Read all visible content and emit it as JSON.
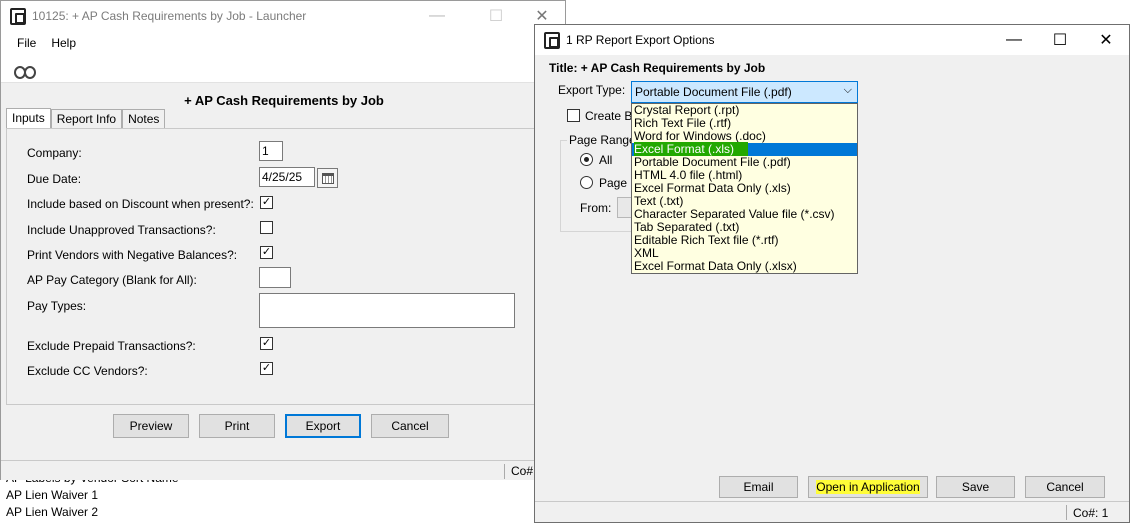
{
  "background_list": [
    "AP Labels by Vendor Sort Name",
    "AP Lien Waiver 1",
    "AP Lien Waiver 2"
  ],
  "launcher": {
    "title": "10125: + AP Cash Requirements by Job - Launcher",
    "controls": {
      "minimize": "—",
      "maximize": "☐",
      "close": "✕"
    },
    "menu": [
      "File",
      "Help"
    ],
    "report_title": "+ AP Cash Requirements by Job",
    "tabs": [
      "Inputs",
      "Report Info",
      "Notes"
    ],
    "fields": {
      "company_label": "Company:",
      "company_value": "1",
      "due_date_label": "Due Date:",
      "due_date_value": "4/25/25",
      "discount_label": "Include based on Discount when present?:",
      "unapproved_label": "Include Unapproved Transactions?:",
      "negative_label": "Print Vendors with Negative Balances?:",
      "pay_category_label": "AP Pay Category (Blank for All):",
      "pay_types_label": "Pay Types:",
      "prepaid_label": "Exclude Prepaid Transactions?:",
      "cc_label": "Exclude CC Vendors?:"
    },
    "checks": {
      "discount": true,
      "unapproved": false,
      "negative": true,
      "prepaid": true,
      "cc": true
    },
    "check_mark": "✓",
    "buttons": {
      "preview": "Preview",
      "print": "Print",
      "export": "Export",
      "cancel": "Cancel"
    },
    "status": "Co#:"
  },
  "dialog": {
    "title": "1 RP Report Export Options",
    "controls": {
      "minimize": "—",
      "maximize": "☐",
      "close": "✕"
    },
    "report_title": "Title:  + AP Cash Requirements by Job",
    "export_type_label": "Export Type:",
    "export_type_value": "Portable Document File (.pdf)",
    "create_label": "Create Bo",
    "page_range_label": "Page Range",
    "all_label": "All",
    "page_label": "Page R",
    "from_label": "From:",
    "dropdown_options": [
      "Crystal Report (.rpt)",
      "Rich Text File (.rtf)",
      "Word for Windows (.doc)",
      "Excel Format (.xls)",
      "Portable Document File (.pdf)",
      "HTML 4.0 file (.html)",
      "Excel Format Data Only (.xls)",
      "Text (.txt)",
      "Character Separated Value file (*.csv)",
      "Tab Separated (.txt)",
      "Editable Rich Text file (*.rtf)",
      "XML",
      "Excel Format Data Only (.xlsx)"
    ],
    "selected_option_index": 3,
    "buttons": {
      "email": "Email",
      "open": "Open in Application",
      "save": "Save",
      "cancel": "Cancel"
    },
    "status": "Co#: 1"
  },
  "colors": {
    "accent": "#0078d7",
    "highlight_marker": "#fffd38",
    "selection_green": "#22a800",
    "dropdown_bg": "#ffffe1"
  }
}
